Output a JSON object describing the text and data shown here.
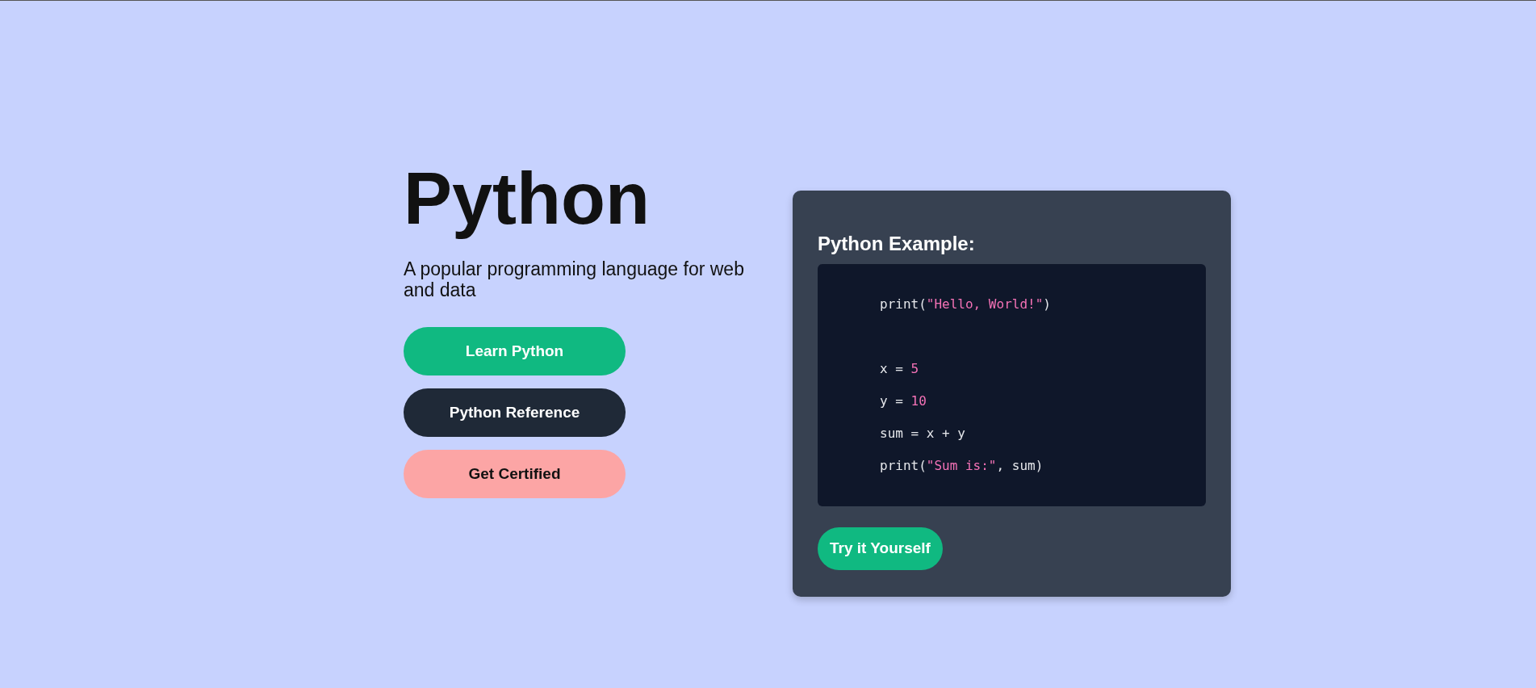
{
  "hero": {
    "title": "Python",
    "subtitle": "A popular programming language for web and data",
    "buttons": [
      {
        "label": "Learn Python",
        "kind": "green"
      },
      {
        "label": "Python Reference",
        "kind": "dark"
      },
      {
        "label": "Get Certified",
        "kind": "pink"
      }
    ]
  },
  "example": {
    "heading": "Python Example:",
    "code_lines": [
      {
        "kind": "code",
        "tokens": [
          {
            "text": "print(",
            "kind": "plain"
          },
          {
            "text": "\"Hello, World!\"",
            "kind": "string"
          },
          {
            "text": ")",
            "kind": "plain"
          }
        ]
      },
      {
        "kind": "blank"
      },
      {
        "kind": "code",
        "tokens": [
          {
            "text": "x = ",
            "kind": "plain"
          },
          {
            "text": "5",
            "kind": "number"
          }
        ]
      },
      {
        "kind": "code",
        "tokens": [
          {
            "text": "y = ",
            "kind": "plain"
          },
          {
            "text": "10",
            "kind": "number"
          }
        ]
      },
      {
        "kind": "code",
        "tokens": [
          {
            "text": "sum = x + y",
            "kind": "plain"
          }
        ]
      },
      {
        "kind": "code",
        "tokens": [
          {
            "text": "print(",
            "kind": "plain"
          },
          {
            "text": "\"Sum is:\"",
            "kind": "string"
          },
          {
            "text": ", sum)",
            "kind": "plain"
          }
        ]
      }
    ],
    "button": {
      "label": "Try it Yourself"
    }
  }
}
